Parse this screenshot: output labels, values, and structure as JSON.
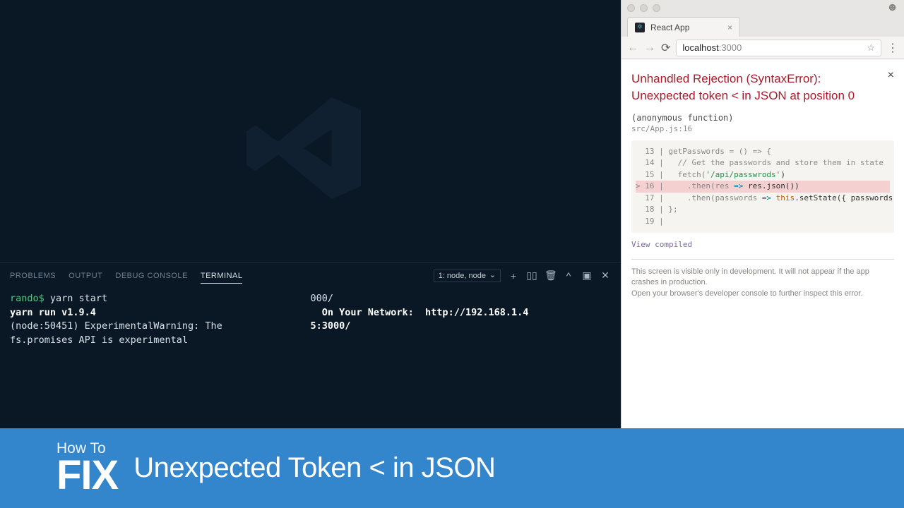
{
  "vscode": {
    "tabs": {
      "problems": "PROBLEMS",
      "output": "OUTPUT",
      "debug": "DEBUG CONSOLE",
      "terminal": "TERMINAL"
    },
    "term_selector": "1: node, node",
    "terminal": {
      "col1": {
        "prompt": "rando$ ",
        "cmd": "yarn start",
        "line2": "yarn run v1.9.4",
        "line3": "(node:50451) ExperimentalWarning: The",
        "line4": "fs.promises API is experimental"
      },
      "col2": {
        "line1": "000/",
        "line2": "  On Your Network:  http://192.168.1.4",
        "line3": "5:3000/"
      }
    }
  },
  "browser": {
    "tab_title": "React App",
    "url_host": "localhost",
    "url_port": ":3000",
    "error_title": "Unhandled Rejection (SyntaxError): Unexpected token < in JSON at position 0",
    "anon": "(anonymous function)",
    "file": "src/App.js:16",
    "code": {
      "l13": "  13 | getPasswords = () => {",
      "l14_a": "  14 |   ",
      "l14_b": "// Get the passwords and store them in state",
      "l15_a": "  15 |   fetch(",
      "l15_b": "'/api/passwrods'",
      "l15_c": ")",
      "l16_a": "> 16 |     .then(res ",
      "l16_b": "=>",
      "l16_c": " res.json())",
      "l17_a": "  17 |     .then(passwords ",
      "l17_b": "=>",
      "l17_c": " ",
      "l17_d": "this",
      "l17_e": ".setState({ passwords }));",
      "l18": "  18 | };",
      "l19": "  19 | "
    },
    "view_compiled": "View compiled",
    "footer1": "This screen is visible only in development. It will not appear if the app crashes in production.",
    "footer2": "Open your browser's developer console to further inspect this error."
  },
  "banner": {
    "howto": "How To",
    "fix": "FIX",
    "message": "Unexpected Token < in JSON"
  }
}
